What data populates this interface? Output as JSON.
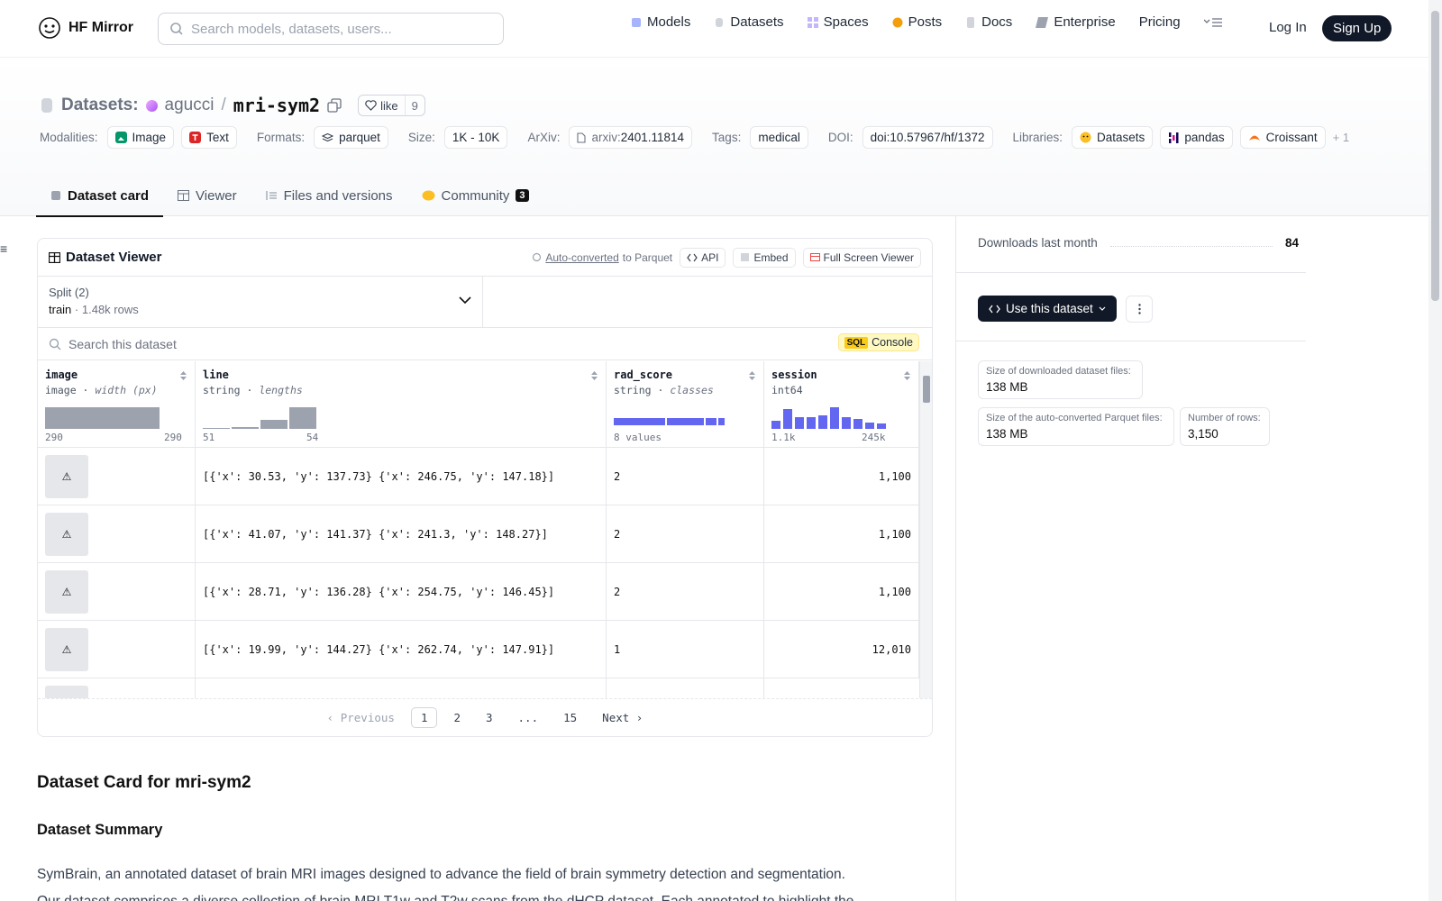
{
  "nav": {
    "brand": "HF Mirror",
    "search_placeholder": "Search models, datasets, users...",
    "links": [
      "Models",
      "Datasets",
      "Spaces",
      "Posts",
      "Docs",
      "Enterprise",
      "Pricing"
    ],
    "login": "Log In",
    "signup": "Sign Up"
  },
  "header": {
    "section": "Datasets:",
    "org": "agucci",
    "repo": "mri-sym2",
    "like_label": "like",
    "like_count": "9",
    "modalities_label": "Modalities:",
    "modalities": [
      "Image",
      "Text"
    ],
    "formats_label": "Formats:",
    "format": "parquet",
    "size_label": "Size:",
    "size": "1K - 10K",
    "arxiv_label": "ArXiv:",
    "arxiv_prefix": "arxiv:",
    "arxiv_id": "2401.11814",
    "tags_label": "Tags:",
    "tag": "medical",
    "doi_label": "DOI:",
    "doi": "doi:10.57967/hf/1372",
    "libraries_label": "Libraries:",
    "libraries": [
      "Datasets",
      "pandas",
      "Croissant"
    ],
    "more_libraries": "+ 1"
  },
  "tabs": [
    {
      "label": "Dataset card"
    },
    {
      "label": "Viewer"
    },
    {
      "label": "Files and versions"
    },
    {
      "label": "Community",
      "badge": "3"
    }
  ],
  "viewer": {
    "title": "Dataset Viewer",
    "auto_converted": "Auto-converted",
    "to_parquet": "to Parquet",
    "api": "API",
    "embed": "Embed",
    "fullscreen": "Full Screen Viewer",
    "split_label": "Split (2)",
    "split_value": "train",
    "split_rows": "1.48k rows",
    "search_placeholder": "Search this dataset",
    "sql_badge": "SQL",
    "sql_label": "Console",
    "columns": [
      {
        "name": "image",
        "type": "image",
        "stat": "width (px)",
        "min": "290",
        "max": "290",
        "hist": [
          1.0
        ]
      },
      {
        "name": "line",
        "type": "string",
        "stat": "lengths",
        "min": "51",
        "max": "54",
        "hist": [
          0.04,
          0.08,
          0.4,
          1.0
        ]
      },
      {
        "name": "rad_score",
        "type": "string",
        "stat": "classes",
        "min": "8 values",
        "max": "",
        "classes": [
          0.46,
          0.33,
          0.1,
          0.06
        ]
      },
      {
        "name": "session",
        "type": "int64",
        "stat": "",
        "min": "1.1k",
        "max": "245k",
        "hist": [
          0.38,
          0.92,
          0.54,
          0.54,
          0.62,
          1.0,
          0.54,
          0.46,
          0.31,
          0.23
        ]
      }
    ],
    "rows": [
      {
        "line": "[{'x': 30.53, 'y': 137.73} {'x': 246.75, 'y': 147.18}]",
        "rad_score": "2",
        "session": "1,100"
      },
      {
        "line": "[{'x': 41.07, 'y': 141.37} {'x': 241.3, 'y': 148.27}]",
        "rad_score": "2",
        "session": "1,100"
      },
      {
        "line": "[{'x': 28.71, 'y': 136.28} {'x': 254.75, 'y': 146.45}]",
        "rad_score": "2",
        "session": "1,100"
      },
      {
        "line": "[{'x': 19.99, 'y': 144.27} {'x': 262.74, 'y': 147.91}]",
        "rad_score": "1",
        "session": "12,010"
      }
    ],
    "pager": {
      "prev": "Previous",
      "pages": [
        "1",
        "2",
        "3",
        "...",
        "15"
      ],
      "next": "Next",
      "current": "1"
    }
  },
  "side": {
    "downloads_label": "Downloads last month",
    "downloads": "84",
    "use_button": "Use this dataset",
    "stats": [
      {
        "label": "Size of downloaded dataset files:",
        "value": "138 MB"
      },
      {
        "label": "Size of the auto-converted Parquet files:",
        "value": "138 MB"
      },
      {
        "label": "Number of rows:",
        "value": "3,150"
      }
    ]
  },
  "card": {
    "h1": "Dataset Card for mri-sym2",
    "h2": "Dataset Summary",
    "p1": "SymBrain, an annotated dataset of brain MRI images designed to advance the field of brain symmetry detection and segmentation.",
    "p2": "Our dataset comprises a diverse collection of brain MRI T1w and T2w scans from the dHCP dataset. Each annotated to highlight the"
  },
  "colors": {
    "accent": "#6366f1",
    "dark": "#111827",
    "hist_gray": "#9ca3af"
  }
}
